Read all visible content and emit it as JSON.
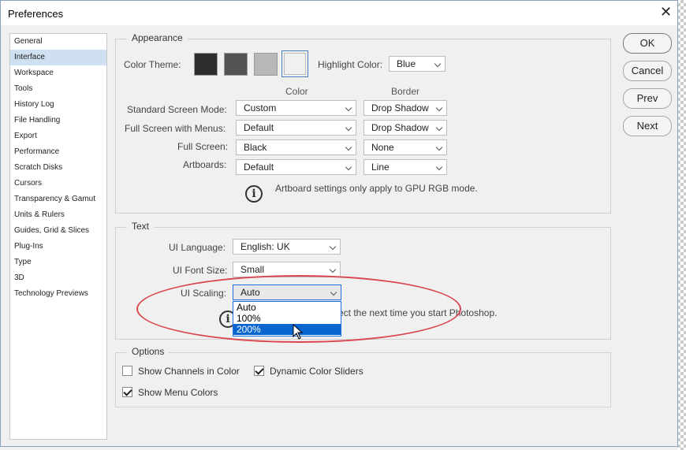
{
  "window": {
    "title": "Preferences",
    "close_glyph": "✕"
  },
  "sidebar": {
    "items": [
      {
        "label": "General"
      },
      {
        "label": "Interface",
        "active": true
      },
      {
        "label": "Workspace"
      },
      {
        "label": "Tools"
      },
      {
        "label": "History Log"
      },
      {
        "label": "File Handling"
      },
      {
        "label": "Export"
      },
      {
        "label": "Performance"
      },
      {
        "label": "Scratch Disks"
      },
      {
        "label": "Cursors"
      },
      {
        "label": "Transparency & Gamut"
      },
      {
        "label": "Units & Rulers"
      },
      {
        "label": "Guides, Grid & Slices"
      },
      {
        "label": "Plug-Ins"
      },
      {
        "label": "Type"
      },
      {
        "label": "3D"
      },
      {
        "label": "Technology Previews"
      }
    ]
  },
  "appearance": {
    "group_label": "Appearance",
    "color_theme_label": "Color Theme:",
    "themes": [
      {
        "color": "#2d2d2d"
      },
      {
        "color": "#535353"
      },
      {
        "color": "#b8b8b8"
      },
      {
        "color": "#f0f0f0",
        "selected": true
      }
    ],
    "highlight_label": "Highlight Color:",
    "highlight_value": "Blue",
    "col_color": "Color",
    "col_border": "Border",
    "rows": [
      {
        "label": "Standard Screen Mode:",
        "color": "Custom",
        "border": "Drop Shadow"
      },
      {
        "label": "Full Screen with Menus:",
        "color": "Default",
        "border": "Drop Shadow"
      },
      {
        "label": "Full Screen:",
        "color": "Black",
        "border": "None"
      },
      {
        "label": "Artboards:",
        "color": "Default",
        "border": "Line"
      }
    ],
    "info_glyph": "i",
    "note": "Artboard settings only apply to GPU RGB mode."
  },
  "text_group": {
    "group_label": "Text",
    "ui_language_label": "UI Language:",
    "ui_language_value": "English: UK",
    "ui_font_size_label": "UI Font Size:",
    "ui_font_size_value": "Small",
    "ui_scaling_label": "UI Scaling:",
    "ui_scaling_value": "Auto",
    "ui_scaling_options": [
      "Auto",
      "100%",
      "200%"
    ],
    "ui_scaling_highlighted": "200%",
    "info_glyph": "i",
    "note_partial": "ect the next time you start Photoshop."
  },
  "options": {
    "group_label": "Options",
    "show_channels_in_color": {
      "label": "Show Channels in Color",
      "checked": false
    },
    "dynamic_color_sliders": {
      "label": "Dynamic Color Sliders",
      "checked": true
    },
    "show_menu_colors": {
      "label": "Show Menu Colors",
      "checked": true
    }
  },
  "buttons": {
    "ok": "OK",
    "cancel": "Cancel",
    "prev": "Prev",
    "next": "Next"
  },
  "colors": {
    "accent": "#0a66cf",
    "annotation": "#d9484f",
    "sidebar_active": "#cfe0f1"
  }
}
